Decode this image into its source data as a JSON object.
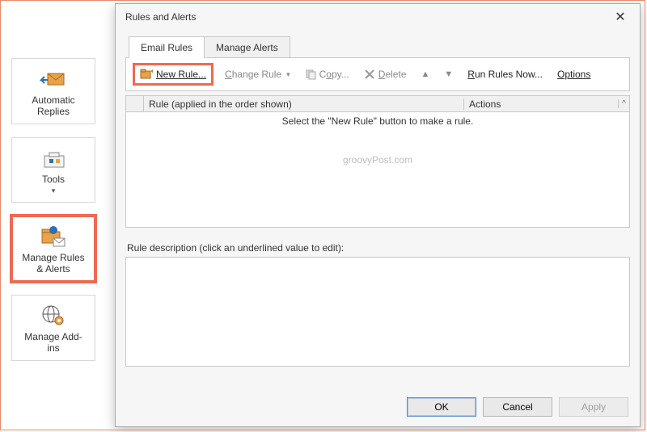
{
  "sidebar": {
    "automatic_replies": "Automatic\nReplies",
    "tools": "Tools",
    "manage_rules": "Manage Rules\n& Alerts",
    "manage_addins": "Manage Add-\nins"
  },
  "dialog": {
    "title": "Rules and Alerts",
    "tabs": {
      "email_rules": "Email Rules",
      "manage_alerts": "Manage Alerts"
    },
    "toolbar": {
      "new_rule": "New Rule...",
      "change_rule": "Change Rule",
      "copy": "Copy...",
      "delete": "Delete",
      "run_rules_now": "Run Rules Now...",
      "options": "Options"
    },
    "columns": {
      "rule": "Rule (applied in the order shown)",
      "actions": "Actions"
    },
    "empty_hint": "Select the \"New Rule\" button to make a rule.",
    "watermark": "groovyPost.com",
    "description_label": "Rule description (click an underlined value to edit):",
    "buttons": {
      "ok": "OK",
      "cancel": "Cancel",
      "apply": "Apply"
    }
  }
}
